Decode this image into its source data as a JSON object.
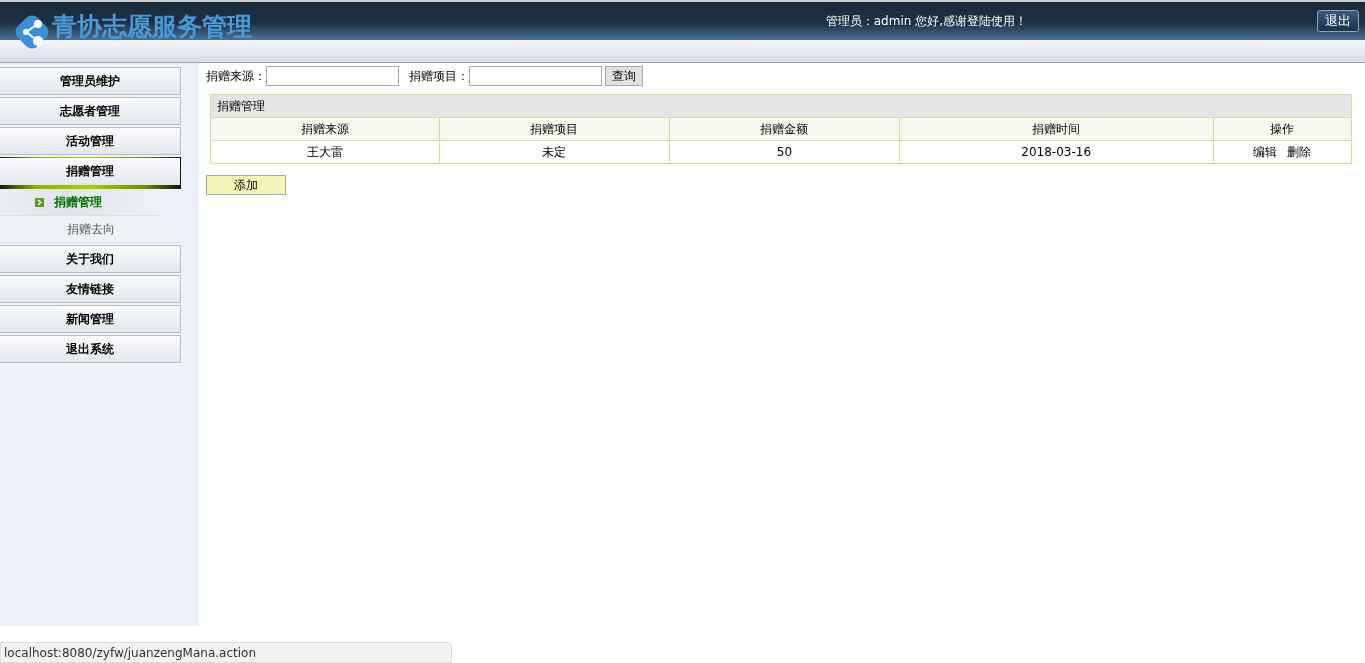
{
  "header": {
    "title": "青协志愿服务管理",
    "greeting": "管理员：admin 您好,感谢登陆使用！",
    "logout_button": "退出"
  },
  "sidebar": {
    "items": [
      {
        "label": "管理员维护",
        "expanded": false
      },
      {
        "label": "志愿者管理",
        "expanded": false
      },
      {
        "label": "活动管理",
        "expanded": false
      },
      {
        "label": "捐赠管理",
        "expanded": true,
        "children": [
          {
            "label": "捐赠管理",
            "selected": true
          },
          {
            "label": "捐赠去向",
            "selected": false
          }
        ]
      },
      {
        "label": "关于我们",
        "expanded": false
      },
      {
        "label": "友情链接",
        "expanded": false
      },
      {
        "label": "新闻管理",
        "expanded": false
      },
      {
        "label": "退出系统",
        "expanded": false
      }
    ]
  },
  "search": {
    "fields": [
      {
        "label": "捐赠来源："
      },
      {
        "label": "捐赠项目："
      }
    ],
    "query_button": "查询"
  },
  "table": {
    "title": "捐赠管理",
    "columns": [
      "捐赠来源",
      "捐赠项目",
      "捐赠金额",
      "捐赠时间",
      "操作"
    ],
    "rows": [
      {
        "cells": [
          "王大雷",
          "未定",
          "50",
          "2018-03-16"
        ],
        "actions": [
          "编辑",
          "删除"
        ]
      }
    ]
  },
  "add_button": "添加",
  "status_bar": {
    "url": "localhost:8080/zyfw/juanzengMana.action"
  }
}
